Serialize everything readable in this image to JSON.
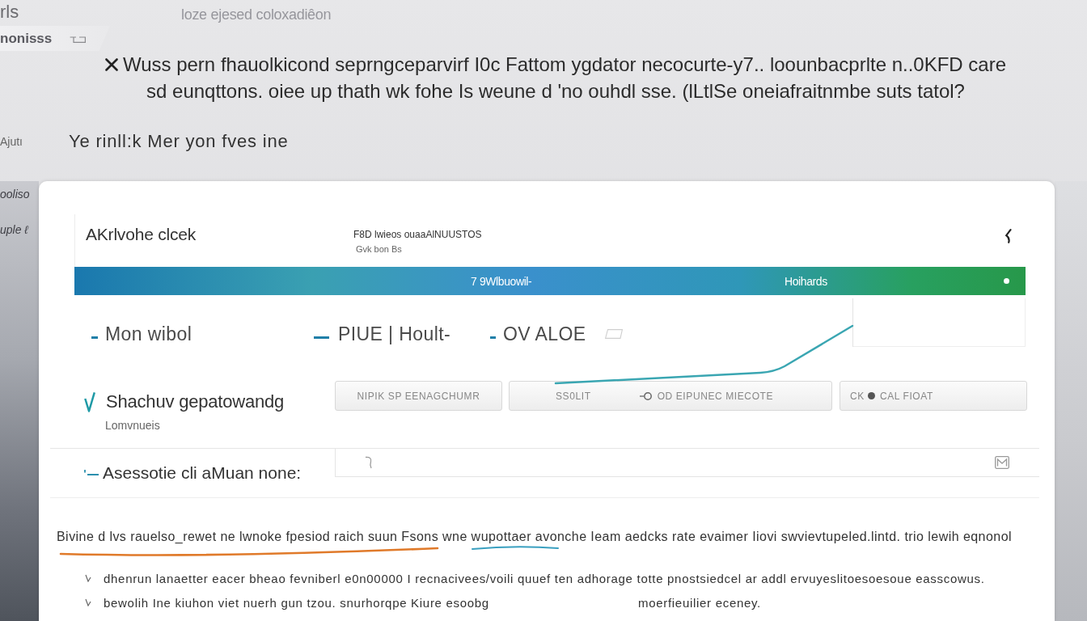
{
  "backdrop": {
    "corner_label": "rls",
    "tab_label": "nonisss",
    "caption": "loze ejesed coloxadiêon",
    "note_side_label": "Ajutı",
    "side_labels": [
      "ooliso",
      "uple ℓ"
    ]
  },
  "message": {
    "lines": [
      "Wuss pern fhauolkicond seprngceparvirf I0c Fattom ygdator necocurte-y7.. loounbacprlte n..0KFD care",
      "sd eunqttons. oiee up thath wk fohe Is weune d 'no ouhdl sse. (lLtlSe oneiafraitnmbe suts tatol?"
    ],
    "note": "Ye rinll:k Mer yon fves ine"
  },
  "card": {
    "header": {
      "title": "AKrlvohe clcek",
      "meta": [
        "F8D lwieos ouaaAlNUUSTOS",
        "Gvk bon Bs"
      ]
    },
    "banner": {
      "labels": [
        "7 9Wlbuowil-",
        "Hoihards"
      ]
    },
    "sections": [
      {
        "label": "Mon wibol"
      },
      {
        "label": "PIUE | Hoult-"
      },
      {
        "label": "OV ALOE"
      }
    ],
    "option": {
      "label": "Shachuv gepatowandg",
      "hint": "Lomvnueis",
      "checked": true
    },
    "buttons": [
      {
        "label": "NIPIK SP EENAGCHUMR"
      },
      {
        "label": "SS0LIT",
        "detail": "OD EIPUNEC MIECOTE"
      },
      {
        "label": "CK",
        "detail": "CAL FIOAT"
      }
    ],
    "field": {
      "label": "Asessotie cli aMuan none:"
    },
    "paragraph": "Bivine d lvs rauelso_rewet ne lwnoke fpesiod raich suun Fsons wne wupottaer avonche Ieam aedcks rate evaimer Iiovi swvievtupeled.lintd. trio lewih eqnonol",
    "bullets": [
      {
        "texts": [
          "dhenrun lanaetter eacer bheao fevniberl e0n00000 I recnacivees/voili quuef ten adhorage totte pnostsiedcel ar addl ervuyeslitoesoesoue easscowus."
        ]
      },
      {
        "texts": [
          "bewolih Ine kiuhon viet nuerh gun tzou. snurhorqpe Kiure esoobg",
          "moerfieuilier eceney."
        ]
      }
    ]
  }
}
